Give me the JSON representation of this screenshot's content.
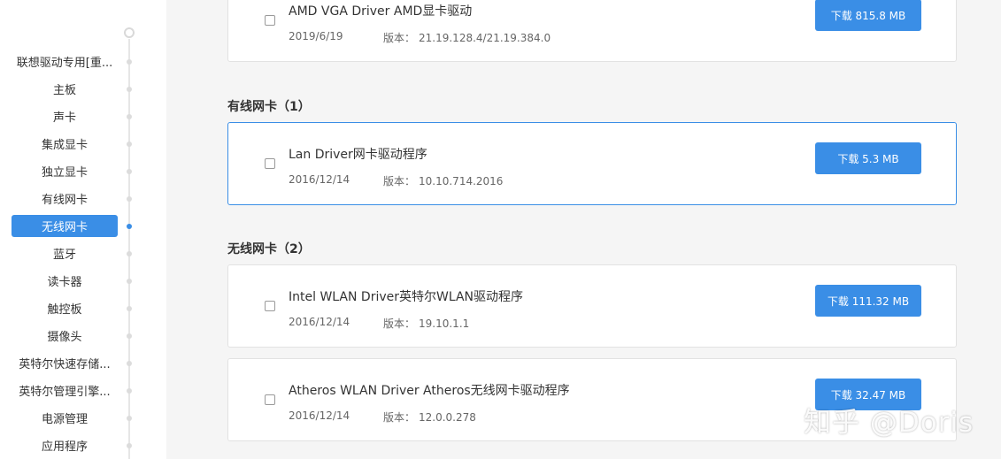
{
  "sidebar": {
    "items": [
      {
        "label": "联想驱动专用[重...",
        "active": false
      },
      {
        "label": "主板",
        "active": false
      },
      {
        "label": "声卡",
        "active": false
      },
      {
        "label": "集成显卡",
        "active": false
      },
      {
        "label": "独立显卡",
        "active": false
      },
      {
        "label": "有线网卡",
        "active": false
      },
      {
        "label": "无线网卡",
        "active": true
      },
      {
        "label": "蓝牙",
        "active": false
      },
      {
        "label": "读卡器",
        "active": false
      },
      {
        "label": "触控板",
        "active": false
      },
      {
        "label": "摄像头",
        "active": false
      },
      {
        "label": "英特尔快速存储...",
        "active": false
      },
      {
        "label": "英特尔管理引擎...",
        "active": false
      },
      {
        "label": "电源管理",
        "active": false
      },
      {
        "label": "应用程序",
        "active": false
      }
    ],
    "accent_color": "#3a8ee6"
  },
  "main": {
    "drivers": [
      {
        "name": "AMD VGA Driver AMD显卡驱动",
        "date": "2019/6/19",
        "version_label": "版本：",
        "version": "21.19.128.4/21.19.384.0",
        "download_label": "下载 815.8 MB"
      },
      {
        "name": "Lan Driver网卡驱动程序",
        "date": "2016/12/14",
        "version_label": "版本：",
        "version": "10.10.714.2016",
        "download_label": "下载 5.3 MB"
      },
      {
        "name": "Intel WLAN Driver英特尔WLAN驱动程序",
        "date": "2016/12/14",
        "version_label": "版本：",
        "version": "19.10.1.1",
        "download_label": "下载 111.32 MB"
      },
      {
        "name": "Atheros WLAN Driver Atheros无线网卡驱动程序",
        "date": "2016/12/14",
        "version_label": "版本：",
        "version": "12.0.0.278",
        "download_label": "下载 32.47 MB"
      }
    ],
    "sections": [
      {
        "title": "有线网卡（1）"
      },
      {
        "title": "无线网卡（2）"
      }
    ]
  },
  "watermark": {
    "text": "知乎 @Doris"
  }
}
